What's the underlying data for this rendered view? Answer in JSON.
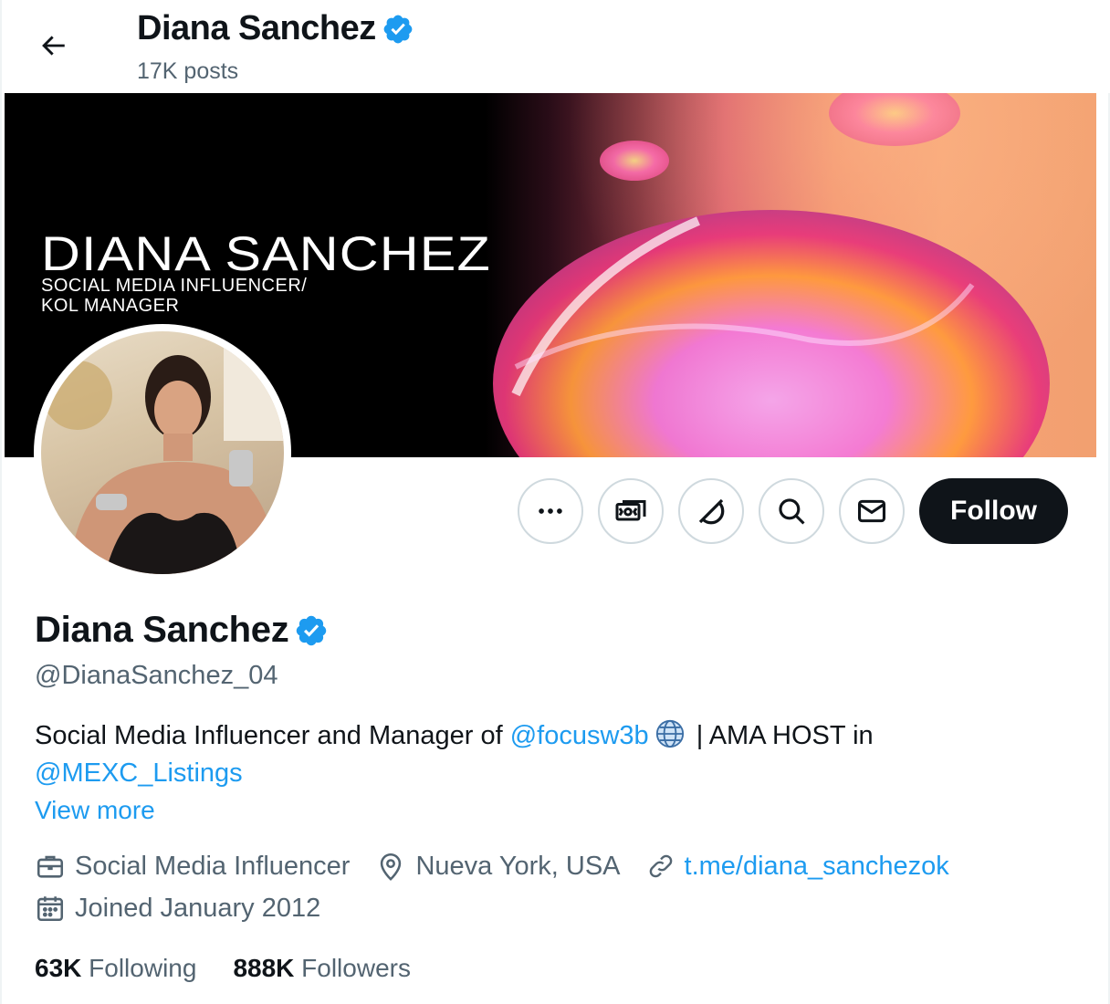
{
  "header": {
    "name": "Diana Sanchez",
    "posts": "17K posts"
  },
  "banner": {
    "title": "DIANA SANCHEZ",
    "subtitle_line1": "SOCIAL MEDIA INFLUENCER/",
    "subtitle_line2": "KOL MANAGER"
  },
  "actions": {
    "more_icon": "more-horizontal-icon",
    "subscribe_icon": "money-icon",
    "grok_icon": "grok-icon",
    "search_icon": "search-icon",
    "message_icon": "envelope-icon",
    "follow_label": "Follow"
  },
  "profile": {
    "name": "Diana Sanchez",
    "handle": "@DianaSanchez_04",
    "bio_text1": "Social Media Influencer and Manager of ",
    "bio_link1": "@focusw3b",
    "bio_text2": " | AMA HOST in",
    "bio_link2": "@MEXC_Listings",
    "view_more": "View more",
    "profession": "Social Media Influencer",
    "location": "Nueva York, USA",
    "website": "t.me/diana_sanchezok",
    "joined": "Joined January 2012"
  },
  "stats": {
    "following_count": "63K",
    "following_label": "Following",
    "followers_count": "888K",
    "followers_label": "Followers"
  },
  "colors": {
    "accent": "#1d9bf0",
    "text_primary": "#0f1419",
    "text_secondary": "#536471",
    "follow_bg": "#0f1419"
  }
}
